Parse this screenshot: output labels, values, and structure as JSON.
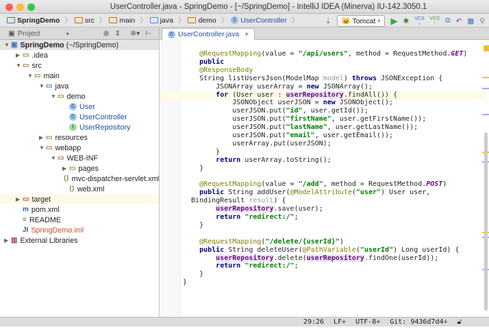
{
  "window": {
    "title": "UserController.java - SpringDemo - [~/SpringDemo] - IntelliJ IDEA (Minerva) IU-142.3050.1"
  },
  "breadcrumbs": [
    "SpringDemo",
    "src",
    "main",
    "java",
    "demo",
    "UserController"
  ],
  "toolbar": {
    "run_config": "Tomcat",
    "vcs_label": "VCS"
  },
  "project_panel": {
    "label": "Project"
  },
  "editor_tab": {
    "label": "UserController.java",
    "close": "×"
  },
  "tree": [
    {
      "label": "SpringDemo",
      "suffix": " (~/SpringDemo)",
      "depth": 0,
      "arrow": "down",
      "icon": "module",
      "bold": true,
      "selected": true
    },
    {
      "label": ".idea",
      "depth": 1,
      "arrow": "right",
      "icon": "folder"
    },
    {
      "label": "src",
      "depth": 1,
      "arrow": "down",
      "icon": "folder"
    },
    {
      "label": "main",
      "depth": 2,
      "arrow": "down",
      "icon": "folder"
    },
    {
      "label": "java",
      "depth": 3,
      "arrow": "down",
      "icon": "source-folder"
    },
    {
      "label": "demo",
      "depth": 4,
      "arrow": "down",
      "icon": "package"
    },
    {
      "label": "User",
      "depth": 5,
      "icon": "class",
      "color": "#1f4f9a"
    },
    {
      "label": "UserController",
      "depth": 5,
      "icon": "class",
      "color": "#1f4f9a"
    },
    {
      "label": "UserRepository",
      "depth": 5,
      "icon": "interface",
      "color": "#1f4f9a"
    },
    {
      "label": "resources",
      "depth": 3,
      "arrow": "right",
      "icon": "folder"
    },
    {
      "label": "webapp",
      "depth": 3,
      "arrow": "down",
      "icon": "folder"
    },
    {
      "label": "WEB-INF",
      "depth": 4,
      "arrow": "down",
      "icon": "folder"
    },
    {
      "label": "pages",
      "depth": 5,
      "arrow": "right",
      "icon": "folder"
    },
    {
      "label": "mvc-dispatcher-servlet.xml",
      "depth": 5,
      "icon": "xml"
    },
    {
      "label": "web.xml",
      "depth": 5,
      "icon": "xml"
    },
    {
      "label": "target",
      "depth": 1,
      "arrow": "right",
      "icon": "folder-red",
      "highlight": true
    },
    {
      "label": "pom.xml",
      "depth": 1,
      "icon": "maven"
    },
    {
      "label": "README",
      "depth": 1,
      "icon": "text"
    },
    {
      "label": "SpringDemo.iml",
      "depth": 1,
      "icon": "iml",
      "color": "#c0502a"
    },
    {
      "label": "External Libraries",
      "depth": 0,
      "arrow": "right",
      "icon": "libraries"
    }
  ],
  "code": [
    [
      [
        "    ",
        ""
      ],
      [
        "@RequestMapping",
        "ann"
      ],
      [
        "(value = ",
        ""
      ],
      [
        "\"/api/users\"",
        "str"
      ],
      [
        ", method = RequestMethod.",
        ""
      ],
      [
        "GET",
        "const"
      ],
      [
        ")",
        ""
      ]
    ],
    [
      [
        "    ",
        ""
      ],
      [
        "public",
        "kw"
      ]
    ],
    [
      [
        "    ",
        ""
      ],
      [
        "@ResponseBody",
        "ann"
      ]
    ],
    [
      [
        "    String listUsersJson(ModelMap ",
        ""
      ],
      [
        "model",
        "unused"
      ],
      [
        ") ",
        ""
      ],
      [
        "throws",
        "kw"
      ],
      [
        " JSONException {",
        ""
      ]
    ],
    [
      [
        "        JSONArray userArray = ",
        ""
      ],
      [
        "new",
        "kw"
      ],
      [
        " JSONArray();",
        ""
      ]
    ],
    [
      [
        "        ",
        ""
      ],
      [
        "for",
        "kw"
      ],
      [
        " (User user : ",
        ""
      ],
      [
        "userRepository",
        "fld"
      ],
      [
        ".findAll()) {",
        ""
      ]
    ],
    [
      [
        "            JSONObject userJSON = ",
        ""
      ],
      [
        "new",
        "kw"
      ],
      [
        " JSONObject();",
        ""
      ]
    ],
    [
      [
        "            userJSON.put(",
        ""
      ],
      [
        "\"id\"",
        "str"
      ],
      [
        ", user.getId());",
        ""
      ]
    ],
    [
      [
        "            userJSON.put(",
        ""
      ],
      [
        "\"firstName\"",
        "str"
      ],
      [
        ", user.getFirstName());",
        ""
      ]
    ],
    [
      [
        "            userJSON.put(",
        ""
      ],
      [
        "\"lastName\"",
        "str"
      ],
      [
        ", user.getLastName());",
        ""
      ]
    ],
    [
      [
        "            userJSON.put(",
        ""
      ],
      [
        "\"email\"",
        "str"
      ],
      [
        ", user.getEmail());",
        ""
      ]
    ],
    [
      [
        "            userArray.put(userJSON);",
        ""
      ]
    ],
    [
      [
        "        }",
        ""
      ]
    ],
    [
      [
        "        ",
        ""
      ],
      [
        "return",
        "kw"
      ],
      [
        " userArray.toString();",
        ""
      ]
    ],
    [
      [
        "    }",
        ""
      ]
    ],
    [],
    [
      [
        "    ",
        ""
      ],
      [
        "@RequestMapping",
        "ann"
      ],
      [
        "(value = ",
        ""
      ],
      [
        "\"/add\"",
        "str"
      ],
      [
        ", method = RequestMethod.",
        ""
      ],
      [
        "POST",
        "const"
      ],
      [
        ")",
        ""
      ]
    ],
    [
      [
        "    ",
        ""
      ],
      [
        "public",
        "kw"
      ],
      [
        " String addUser(",
        ""
      ],
      [
        "@ModelAttribute",
        "ann"
      ],
      [
        "(",
        ""
      ],
      [
        "\"user\"",
        "str"
      ],
      [
        ") User user,",
        ""
      ]
    ],
    [
      [
        "  BindingResult ",
        ""
      ],
      [
        "result",
        "unused"
      ],
      [
        ") {",
        ""
      ]
    ],
    [
      [
        "        ",
        ""
      ],
      [
        "userRepository",
        "fld"
      ],
      [
        ".save(user);",
        ""
      ]
    ],
    [
      [
        "        ",
        ""
      ],
      [
        "return",
        "kw"
      ],
      [
        " ",
        ""
      ],
      [
        "\"redirect:/\"",
        "str"
      ],
      [
        ";",
        ""
      ]
    ],
    [
      [
        "    }",
        ""
      ]
    ],
    [],
    [
      [
        "    ",
        ""
      ],
      [
        "@RequestMapping",
        "ann"
      ],
      [
        "(",
        ""
      ],
      [
        "\"/delete/{userId}\"",
        "str"
      ],
      [
        ")",
        ""
      ]
    ],
    [
      [
        "    ",
        ""
      ],
      [
        "public",
        "kw"
      ],
      [
        " String deleteUser(",
        ""
      ],
      [
        "@PathVariable",
        "ann"
      ],
      [
        "(",
        ""
      ],
      [
        "\"userId\"",
        "str"
      ],
      [
        ") Long userId) {",
        ""
      ]
    ],
    [
      [
        "        ",
        ""
      ],
      [
        "userRepository",
        "fld"
      ],
      [
        ".delete(",
        ""
      ],
      [
        "userRepository",
        "fld"
      ],
      [
        ".findOne(userId));",
        ""
      ]
    ],
    [
      [
        "        ",
        ""
      ],
      [
        "return",
        "kw"
      ],
      [
        " ",
        ""
      ],
      [
        "\"redirect:/\"",
        "str"
      ],
      [
        ";",
        ""
      ]
    ],
    [
      [
        "    }",
        ""
      ]
    ],
    [
      [
        "}",
        ""
      ]
    ]
  ],
  "status": {
    "position": "29:26",
    "line_sep": "LF÷",
    "encoding": "UTF-8÷",
    "vcs": "Git: 9436d7d4÷"
  }
}
